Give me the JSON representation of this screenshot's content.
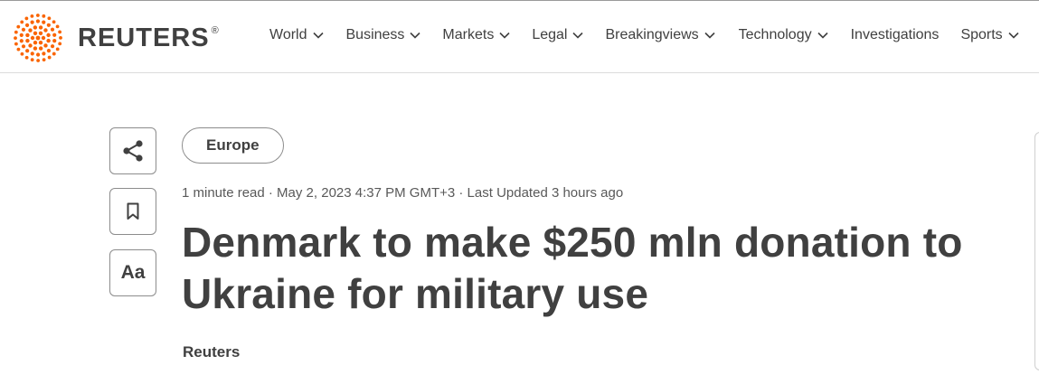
{
  "brand": {
    "name": "REUTERS",
    "registered": "®",
    "accent_color": "#fa6400"
  },
  "nav": {
    "items": [
      {
        "label": "World",
        "has_dropdown": true
      },
      {
        "label": "Business",
        "has_dropdown": true
      },
      {
        "label": "Markets",
        "has_dropdown": true
      },
      {
        "label": "Legal",
        "has_dropdown": true
      },
      {
        "label": "Breakingviews",
        "has_dropdown": true
      },
      {
        "label": "Technology",
        "has_dropdown": true
      },
      {
        "label": "Investigations",
        "has_dropdown": false
      },
      {
        "label": "Sports",
        "has_dropdown": true
      }
    ]
  },
  "tools": {
    "text_size_label": "Aa"
  },
  "article": {
    "section_tag": "Europe",
    "meta": "1 minute read · May 2, 2023 4:37 PM GMT+3 · Last Updated 3 hours ago",
    "headline": "Denmark to make $250 mln donation to Ukraine for military use",
    "byline": "Reuters"
  }
}
